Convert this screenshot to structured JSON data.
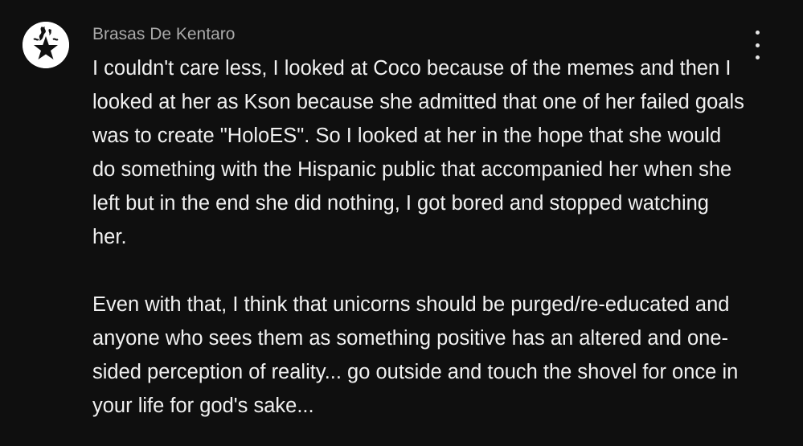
{
  "comment": {
    "author": "Brasas De Kentaro",
    "avatar_icon": "black-star-flame-icon",
    "paragraphs": [
      "I couldn't care less, I looked at Coco because of the memes and then I looked at her as Kson because she admitted that one of her failed goals was to create \"HoloES\". So I looked at her in the hope that she would do something with the Hispanic public that accompanied her when she left but in the end she did nothing, I got bored and stopped watching her.",
      "Even with that, I think that unicorns should be purged/re-educated and anyone who sees them as something positive has an altered and one-sided perception of reality... go outside and touch the shovel for once in your life for god's sake..."
    ],
    "menu_icon": "more-vertical-icon"
  },
  "colors": {
    "background": "#0f0f0f",
    "author": "#aaaaaa",
    "text": "#f1f1f1"
  }
}
